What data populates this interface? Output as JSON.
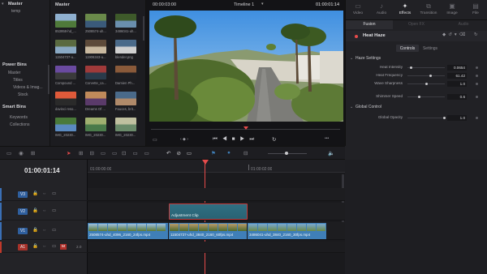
{
  "media_pool": {
    "bins_title": "Master",
    "bins_item": "temp",
    "pool_title": "Master",
    "power_bins_title": "Power Bins",
    "power_bins": [
      "Master",
      "Titles",
      "Videos & Imag...",
      "Stock"
    ],
    "smart_bins_title": "Smart Bins",
    "smart_bins": [
      "Keywords",
      "Collections"
    ],
    "clips": [
      {
        "label": "853958-hd_..."
      },
      {
        "label": "2508574-uh..."
      },
      {
        "label": "3486041-uh..."
      },
      {
        "label": "11504737-u..."
      },
      {
        "label": "11906343-u..."
      },
      {
        "label": "blender.png"
      },
      {
        "label": "Compound ..."
      },
      {
        "label": "Corvette_ca..."
      },
      {
        "label": "Damien Ph..."
      },
      {
        "label": "davinci reso..."
      },
      {
        "label": "Dreams Of ..."
      },
      {
        "label": "Fauces, brit..."
      },
      {
        "label": "IMG_20230..."
      },
      {
        "label": "IMG_20230..."
      },
      {
        "label": "IMG_20230..."
      }
    ]
  },
  "viewer": {
    "source_timecode": "00:00:03:00",
    "timeline_name": "Timeline 1",
    "record_timecode": "01:00:01:14"
  },
  "inspector": {
    "tabs": [
      {
        "label": "Video",
        "icon": "video-icon"
      },
      {
        "label": "Audio",
        "icon": "audio-icon"
      },
      {
        "label": "Effects",
        "icon": "effects-icon"
      },
      {
        "label": "Transition",
        "icon": "transition-icon"
      },
      {
        "label": "Image",
        "icon": "image-icon"
      },
      {
        "label": "File",
        "icon": "file-icon"
      }
    ],
    "active_tab": "Effects",
    "subtabs": [
      "Fusion",
      "Open FX",
      "Audio"
    ],
    "effect_name": "Heat Haze",
    "sub_subtabs": [
      "Controls",
      "Settings"
    ],
    "haze_section": "Haze Settings",
    "params": [
      {
        "label": "Heat Intensity",
        "value": "0.0654",
        "fill": 0.07
      },
      {
        "label": "Heat Frequency",
        "value": "61.42",
        "fill": 0.61
      },
      {
        "label": "Wave Sharpness",
        "value": "1.0",
        "fill": 0.5
      },
      {
        "label": "Shimmer Speed",
        "value": "0.6",
        "fill": 0.3
      }
    ],
    "global_section": "Global Control",
    "global_params": [
      {
        "label": "Global Opacity",
        "value": "1.0",
        "fill": 1.0
      }
    ]
  },
  "timeline": {
    "current_timecode": "01:00:01:14",
    "ruler_labels": [
      "01:00:00:00",
      "01:00:02:00"
    ],
    "tracks": [
      {
        "name": "V3",
        "color": "#3a6fb5"
      },
      {
        "name": "V2",
        "color": "#3a6fb5"
      },
      {
        "name": "V1",
        "color": "#3a6fb5"
      },
      {
        "name": "A1",
        "color": "#c0392b",
        "level": "2.0"
      }
    ],
    "adjustment_clip_label": "Adjustment Clip",
    "v1_clips": [
      {
        "label": "2508574-uhd_4096_2160_24fps.mp4"
      },
      {
        "label": "11504737-uhd_3840_2160_60fps.mp4"
      },
      {
        "label": "3486041-uhd_3840_2160_30fps.mp4"
      }
    ],
    "a1_mute_label": "M"
  },
  "colors": {
    "accent_red": "#e64b4b",
    "clip_blue": "#3f7fb8",
    "adjustment_teal": "#2f6f82"
  }
}
